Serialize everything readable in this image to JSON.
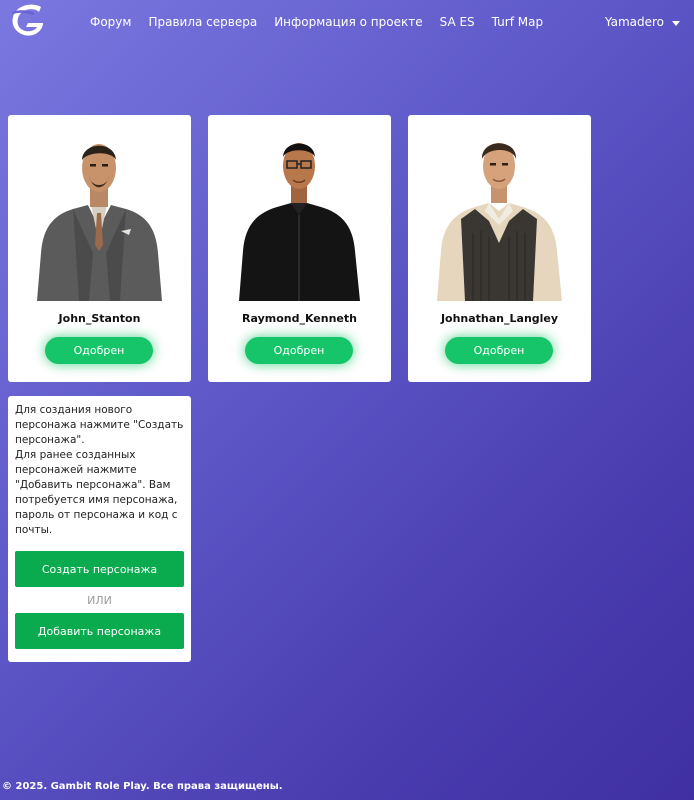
{
  "nav": {
    "logo_icon": "gambit-logo-icon",
    "items": [
      {
        "label": "Форум"
      },
      {
        "label": "Правила сервера"
      },
      {
        "label": "Информация о проекте"
      },
      {
        "label": "SA ES"
      },
      {
        "label": "Turf Map"
      }
    ],
    "user": "Yamadero",
    "user_caret_icon": "chevron-down-icon"
  },
  "characters": [
    {
      "name": "John_Stanton",
      "status": "Одобрен",
      "avatar": "character-avatar-icon"
    },
    {
      "name": "Raymond_Kenneth",
      "status": "Одобрен",
      "avatar": "character-avatar-icon"
    },
    {
      "name": "Johnathan_Langley",
      "status": "Одобрен",
      "avatar": "character-avatar-icon"
    }
  ],
  "info": {
    "p1": "Для создания нового персонажа нажмите \"Создать персонажа\".",
    "p2": "Для ранее созданных персонажей нажмите \"Добавить персонажа\". Вам потребуется имя персонажа, пароль от персонажа и код с почты.",
    "create_label": "Создать персонажа",
    "or_label": "ИЛИ",
    "add_label": "Добавить персонажа"
  },
  "footer": {
    "text": "© 2025. Gambit Role Play. Все права защищены."
  },
  "colors": {
    "accent": "#16c46a",
    "action": "#0aaa4f",
    "background_start": "#7b78e0",
    "background_end": "#3f2fa3"
  }
}
